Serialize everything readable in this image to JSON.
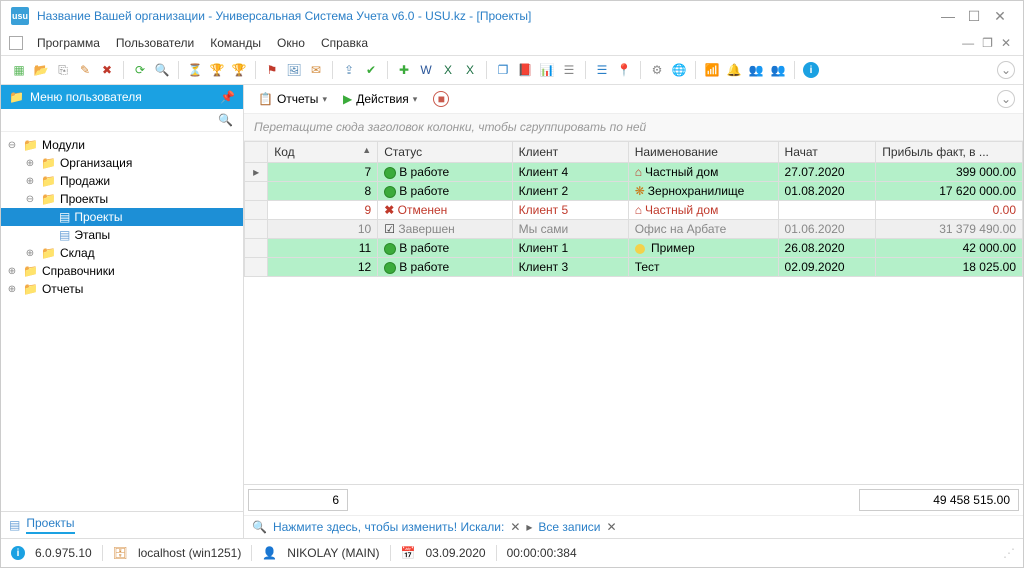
{
  "window": {
    "title": "Название Вашей организации - Универсальная Система Учета v6.0 - USU.kz - [Проекты]"
  },
  "menu": {
    "items": [
      "Программа",
      "Пользователи",
      "Команды",
      "Окно",
      "Справка"
    ]
  },
  "sidebar": {
    "title": "Меню пользователя",
    "tree": [
      {
        "label": "Модули",
        "level": 0,
        "kind": "folder",
        "exp": "⊖"
      },
      {
        "label": "Организация",
        "level": 1,
        "kind": "folder",
        "exp": "⊕"
      },
      {
        "label": "Продажи",
        "level": 1,
        "kind": "folder",
        "exp": "⊕"
      },
      {
        "label": "Проекты",
        "level": 1,
        "kind": "folder",
        "exp": "⊖"
      },
      {
        "label": "Проекты",
        "level": 2,
        "kind": "doc",
        "sel": true
      },
      {
        "label": "Этапы",
        "level": 2,
        "kind": "doc"
      },
      {
        "label": "Склад",
        "level": 1,
        "kind": "folder",
        "exp": "⊕"
      },
      {
        "label": "Справочники",
        "level": 0,
        "kind": "folder",
        "exp": "⊕"
      },
      {
        "label": "Отчеты",
        "level": 0,
        "kind": "folder",
        "exp": "⊕"
      }
    ],
    "tab": "Проекты"
  },
  "main_toolbar": {
    "reports": "Отчеты",
    "actions": "Действия"
  },
  "grid": {
    "group_hint": "Перетащите сюда заголовок колонки, чтобы сгруппировать по ней",
    "columns": [
      "Код",
      "Статус",
      "Клиент",
      "Наименование",
      "Начат",
      "Прибыль факт, в ..."
    ],
    "rows": [
      {
        "mark": "▸",
        "code": "7",
        "status": "В работе",
        "status_type": "work",
        "client": "Клиент 4",
        "name": "Частный дом",
        "name_ic": "house",
        "started": "27.07.2020",
        "profit": "399 000.00",
        "cls": "green"
      },
      {
        "mark": "",
        "code": "8",
        "status": "В работе",
        "status_type": "work",
        "client": "Клиент 2",
        "name": "Зернохранилище",
        "name_ic": "grain",
        "started": "01.08.2020",
        "profit": "17 620 000.00",
        "cls": "green"
      },
      {
        "mark": "",
        "code": "9",
        "status": "Отменен",
        "status_type": "cancel",
        "client": "Клиент 5",
        "name": "Частный дом",
        "name_ic": "house",
        "started": "",
        "profit": "0.00",
        "cls": "red"
      },
      {
        "mark": "",
        "code": "10",
        "status": "Завершен",
        "status_type": "done",
        "client": "Мы сами",
        "name": "Офис на Арбате",
        "name_ic": "",
        "started": "01.06.2020",
        "profit": "31 379 490.00",
        "cls": "gray"
      },
      {
        "mark": "",
        "code": "11",
        "status": "В работе",
        "status_type": "work",
        "client": "Клиент 1",
        "name": "Пример",
        "name_ic": "ball",
        "started": "26.08.2020",
        "profit": "42 000.00",
        "cls": "green"
      },
      {
        "mark": "",
        "code": "12",
        "status": "В работе",
        "status_type": "work",
        "client": "Клиент 3",
        "name": "Тест",
        "name_ic": "",
        "started": "02.09.2020",
        "profit": "18 025.00",
        "cls": "green"
      }
    ],
    "footer_count": "6",
    "footer_sum": "49 458 515.00"
  },
  "filter": {
    "hint": "Нажмите здесь, чтобы изменить! Искали:",
    "all": "Все записи"
  },
  "status": {
    "version": "6.0.975.10",
    "host": "localhost (win1251)",
    "user": "NIKOLAY (MAIN)",
    "date": "03.09.2020",
    "time": "00:00:00:384"
  }
}
